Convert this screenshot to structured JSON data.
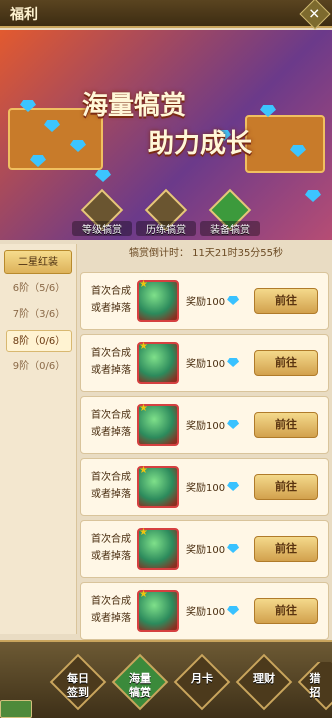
{
  "topbar": {
    "title": "福利"
  },
  "banner": {
    "line1": "海量犒赏",
    "line2": "助力成长"
  },
  "tabs": [
    {
      "label": "等级犒赏"
    },
    {
      "label": "历练犒赏"
    },
    {
      "label": "装备犒赏",
      "active": true
    }
  ],
  "timer": "犒赏倒计时： 11天21时35分55秒",
  "sidebar": {
    "header": "二星红装",
    "items": [
      "6阶（5/6）",
      "7阶（3/6）",
      "8阶（0/6）",
      "9阶（0/6）"
    ],
    "selected": "8阶（0/6）"
  },
  "cards": [
    {
      "desc": "首次合成或者掉落",
      "reward": "奖励100",
      "button": "前往"
    },
    {
      "desc": "首次合成或者掉落",
      "reward": "奖励100",
      "button": "前往"
    },
    {
      "desc": "首次合成或者掉落",
      "reward": "奖励100",
      "button": "前往"
    },
    {
      "desc": "首次合成或者掉落",
      "reward": "奖励100",
      "button": "前往"
    },
    {
      "desc": "首次合成或者掉落",
      "reward": "奖励100",
      "button": "前往"
    },
    {
      "desc": "首次合成或者掉落",
      "reward": "奖励100",
      "button": "前往"
    }
  ],
  "bottom_nav": [
    {
      "label": "每日\n签到"
    },
    {
      "label": "海量\n犒赏",
      "active": true
    },
    {
      "label": "月卡"
    },
    {
      "label": "理财"
    },
    {
      "label": "猎\n招"
    }
  ],
  "icons": {
    "close": "close-icon",
    "gem": "diamond-icon",
    "chest": "treasure-chest-icon",
    "back": "back-arrow-icon"
  }
}
